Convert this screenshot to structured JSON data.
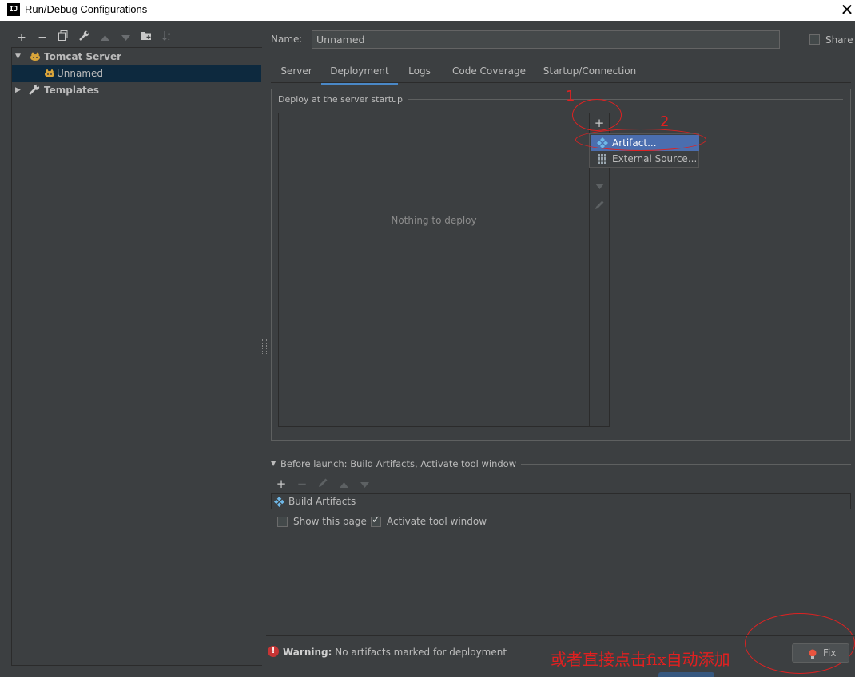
{
  "window": {
    "title": "Run/Debug Configurations",
    "app_icon": "IJ",
    "close_symbol": "✕"
  },
  "left_toolbar": {
    "add": "+",
    "remove": "−"
  },
  "tree": {
    "tomcat": {
      "label": "Tomcat Server"
    },
    "unnamed": {
      "label": "Unnamed"
    },
    "templates": {
      "label": "Templates"
    }
  },
  "config": {
    "name_label": "Name:",
    "name_value": "Unnamed",
    "share_label": "Share",
    "share_checked": false
  },
  "tabs": [
    {
      "label": "Server"
    },
    {
      "label": "Deployment"
    },
    {
      "label": "Logs"
    },
    {
      "label": "Code Coverage"
    },
    {
      "label": "Startup/Connection"
    }
  ],
  "active_tab": "Deployment",
  "deployment": {
    "group_title": "Deploy at the server startup",
    "empty_text": "Nothing to deploy",
    "add_button": "+"
  },
  "popup": {
    "items": [
      {
        "label": "Artifact...",
        "selected": true
      },
      {
        "label": "External Source..."
      }
    ]
  },
  "annotations": {
    "step1": "1",
    "step2": "2",
    "note": "或者直接点击fix自动添加"
  },
  "before_launch": {
    "title": "Before launch: Build Artifacts, Activate tool window",
    "add": "+",
    "remove": "−",
    "item": "Build Artifacts",
    "show_page": {
      "label": "Show this page",
      "checked": false
    },
    "activate_window": {
      "label": "Activate tool window",
      "checked": true
    }
  },
  "warning": {
    "label": "Warning:",
    "message": "No artifacts marked for deployment",
    "fix_label": "Fix"
  },
  "colors": {
    "accent": "#4a88c7",
    "selection": "#0d293e",
    "popup_selection": "#4b6eaf",
    "annotation": "#e02020",
    "background": "#3c3f41"
  }
}
